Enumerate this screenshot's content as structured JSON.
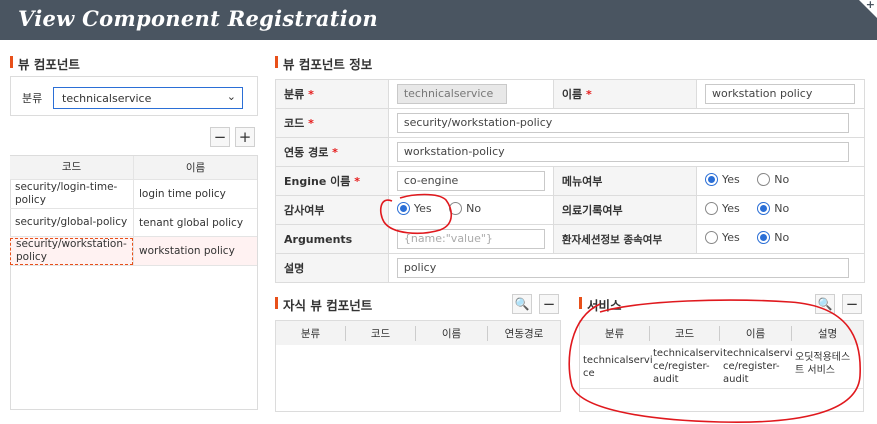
{
  "window": {
    "title": "View Component Registration"
  },
  "left": {
    "section_title": "뷰 컴포넌트",
    "filter_label": "분류",
    "filter_value": "technicalservice",
    "columns": [
      "코드",
      "이름"
    ],
    "rows": [
      {
        "code": "security/login-time-policy",
        "name": "login time policy"
      },
      {
        "code": "security/global-policy",
        "name": "tenant global policy"
      },
      {
        "code": "security/workstation-policy",
        "name": "workstation policy"
      }
    ]
  },
  "detail": {
    "section_title": "뷰 컴포넌트 정보",
    "labels": {
      "category": "분류",
      "name": "이름",
      "code": "코드",
      "path": "연동 경로",
      "engine": "Engine 이름",
      "menu": "메뉴여부",
      "audit": "감사여부",
      "medical": "의료기록여부",
      "arguments": "Arguments",
      "patient_session": "환자세션정보 종속여부",
      "desc": "설명"
    },
    "required_mark": "*",
    "values": {
      "category": "technicalservice",
      "name": "workstation policy",
      "code": "security/workstation-policy",
      "path": "workstation-policy",
      "engine": "co-engine",
      "arguments_placeholder": "{name:\"value\"}",
      "desc": "policy"
    },
    "radio_yes": "Yes",
    "radio_no": "No"
  },
  "children": {
    "section_title": "자식 뷰 컴포넌트",
    "columns": [
      "분류",
      "코드",
      "이름",
      "연동경로"
    ]
  },
  "services": {
    "section_title": "서비스",
    "columns": [
      "분류",
      "코드",
      "이름",
      "설명"
    ],
    "row": [
      "technicalservi\nce",
      "technicalservi\nce/register-\naudit",
      "technicalservi\nce/register-\naudit",
      "오딧적용테스\n트 서비스"
    ]
  },
  "colors": {
    "titlebar": "#4a5561",
    "accent": "#e8501a",
    "annotation": "#e0191e",
    "selection": "#fff2f2"
  }
}
